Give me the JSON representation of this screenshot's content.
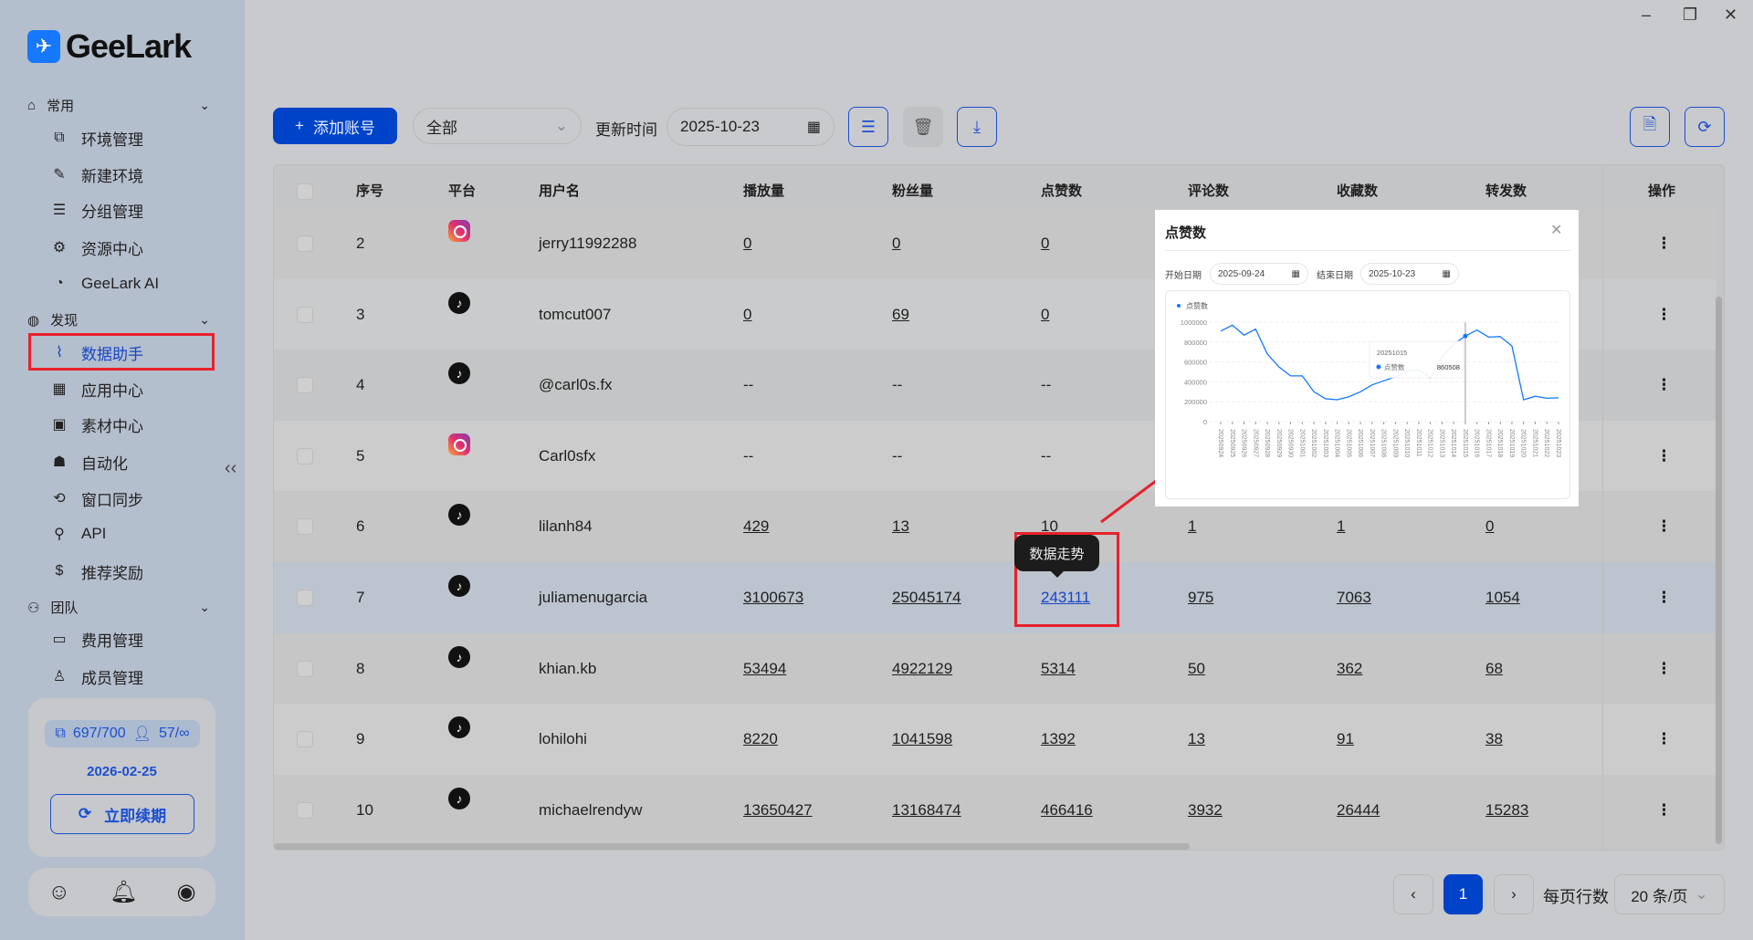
{
  "app": {
    "logo": "GeeLark",
    "window_controls": [
      "minimize",
      "restore",
      "close"
    ]
  },
  "sidebar": {
    "sections": [
      {
        "label": "常用",
        "icon": "home-icon",
        "items": [
          {
            "label": "环境管理",
            "icon": "profile-icon"
          },
          {
            "label": "新建环境",
            "icon": "edit-icon"
          },
          {
            "label": "分组管理",
            "icon": "list-icon"
          },
          {
            "label": "资源中心",
            "icon": "resource-icon"
          },
          {
            "label": "GeeLark AI",
            "icon": "ai-icon"
          }
        ]
      },
      {
        "label": "发现",
        "icon": "planet-icon",
        "items": [
          {
            "label": "数据助手",
            "icon": "chart-icon",
            "active": true
          },
          {
            "label": "应用中心",
            "icon": "apps-icon"
          },
          {
            "label": "素材中心",
            "icon": "media-icon"
          },
          {
            "label": "自动化",
            "icon": "robot-icon"
          },
          {
            "label": "窗口同步",
            "icon": "sync-window-icon"
          },
          {
            "label": "API",
            "icon": "api-icon"
          },
          {
            "label": "推荐奖励",
            "icon": "dollar-icon"
          }
        ]
      },
      {
        "label": "团队",
        "icon": "team-icon",
        "items": [
          {
            "label": "费用管理",
            "icon": "wallet-icon"
          },
          {
            "label": "成员管理",
            "icon": "user-icon"
          }
        ]
      }
    ],
    "quota_profiles": "697/700",
    "quota_members": "57/∞",
    "expire_date": "2026-02-25",
    "renew_label": "立即续期",
    "bottom_icons": [
      "support-icon",
      "bell-icon",
      "account-icon"
    ]
  },
  "toolbar": {
    "add_label": "添加账号",
    "filter_value": "全部",
    "update_time_label": "更新时间",
    "update_time_value": "2025-10-23"
  },
  "table": {
    "columns": [
      "序号",
      "平台",
      "用户名",
      "播放量",
      "粉丝量",
      "点赞数",
      "评论数",
      "收藏数",
      "转发数",
      "操作"
    ],
    "rows": [
      {
        "no": "2",
        "platform": "instagram",
        "user": "jerry11992288",
        "views": "0",
        "fans": "0",
        "likes": "0",
        "comments": "",
        "favs": "",
        "shares": ""
      },
      {
        "no": "3",
        "platform": "tiktok",
        "user": "tomcut007",
        "views": "0",
        "fans": "69",
        "likes": "0",
        "comments": "",
        "favs": "",
        "shares": ""
      },
      {
        "no": "4",
        "platform": "tiktok",
        "user": "@carl0s.fx",
        "views": "--",
        "fans": "--",
        "likes": "--",
        "comments": "",
        "favs": "",
        "shares": ""
      },
      {
        "no": "5",
        "platform": "instagram",
        "user": "Carl0sfx",
        "views": "--",
        "fans": "--",
        "likes": "--",
        "comments": "",
        "favs": "",
        "shares": ""
      },
      {
        "no": "6",
        "platform": "tiktok",
        "user": "lilanh84",
        "views": "429",
        "fans": "13",
        "likes": "10",
        "comments": "1",
        "favs": "1",
        "shares": "0"
      },
      {
        "no": "7",
        "platform": "tiktok",
        "user": "juliamenugarcia",
        "views": "3100673",
        "fans": "25045174",
        "likes": "243111",
        "comments": "975",
        "favs": "7063",
        "shares": "1054"
      },
      {
        "no": "8",
        "platform": "tiktok",
        "user": "khian.kb",
        "views": "53494",
        "fans": "4922129",
        "likes": "5314",
        "comments": "50",
        "favs": "362",
        "shares": "68"
      },
      {
        "no": "9",
        "platform": "tiktok",
        "user": "lohilohi",
        "views": "8220",
        "fans": "1041598",
        "likes": "1392",
        "comments": "13",
        "favs": "91",
        "shares": "38"
      },
      {
        "no": "10",
        "platform": "tiktok",
        "user": "michaelrendyw",
        "views": "13650427",
        "fans": "13168474",
        "likes": "466416",
        "comments": "3932",
        "favs": "26444",
        "shares": "15283"
      }
    ],
    "hover_tooltip": "数据走势"
  },
  "pagination": {
    "current": "1",
    "rows_per_page_label": "每页行数",
    "rows_per_page": "20 条/页"
  },
  "popup": {
    "title": "点赞数",
    "start_label": "开始日期",
    "start_date": "2025-09-24",
    "end_label": "结束日期",
    "end_date": "2025-10-23"
  },
  "chart_data": {
    "type": "line",
    "legend": "点赞数",
    "legend_position": "top-left",
    "ylim": [
      0,
      1000000
    ],
    "yticks": [
      "0",
      "200000",
      "400000",
      "600000",
      "800000",
      "1000000"
    ],
    "x": [
      "20250924",
      "20250925",
      "20250926",
      "20250927",
      "20250928",
      "20250929",
      "20250930",
      "20251001",
      "20251002",
      "20251003",
      "20251004",
      "20251005",
      "20251006",
      "20251007",
      "20251008",
      "20251009",
      "20251010",
      "20251011",
      "20251012",
      "20251013",
      "20251014",
      "20251015",
      "20251016",
      "20251017",
      "20251018",
      "20251019",
      "20251020",
      "20251021",
      "20251022",
      "20251023"
    ],
    "series": [
      {
        "name": "点赞数",
        "color": "#1677ff",
        "values": [
          910000,
          970000,
          870000,
          930000,
          680000,
          550000,
          460000,
          460000,
          300000,
          230000,
          220000,
          250000,
          300000,
          370000,
          410000,
          450000,
          510000,
          520000,
          440000,
          650000,
          780000,
          860508,
          920000,
          850000,
          855000,
          760000,
          220000,
          255000,
          235000,
          240000
        ]
      }
    ],
    "tooltip": {
      "x": "20251015",
      "label": "点赞数",
      "value": "860508"
    },
    "grid": true
  },
  "colors": {
    "accent": "#0043c9",
    "highlight": "#e8212b",
    "line": "#1677ff"
  }
}
